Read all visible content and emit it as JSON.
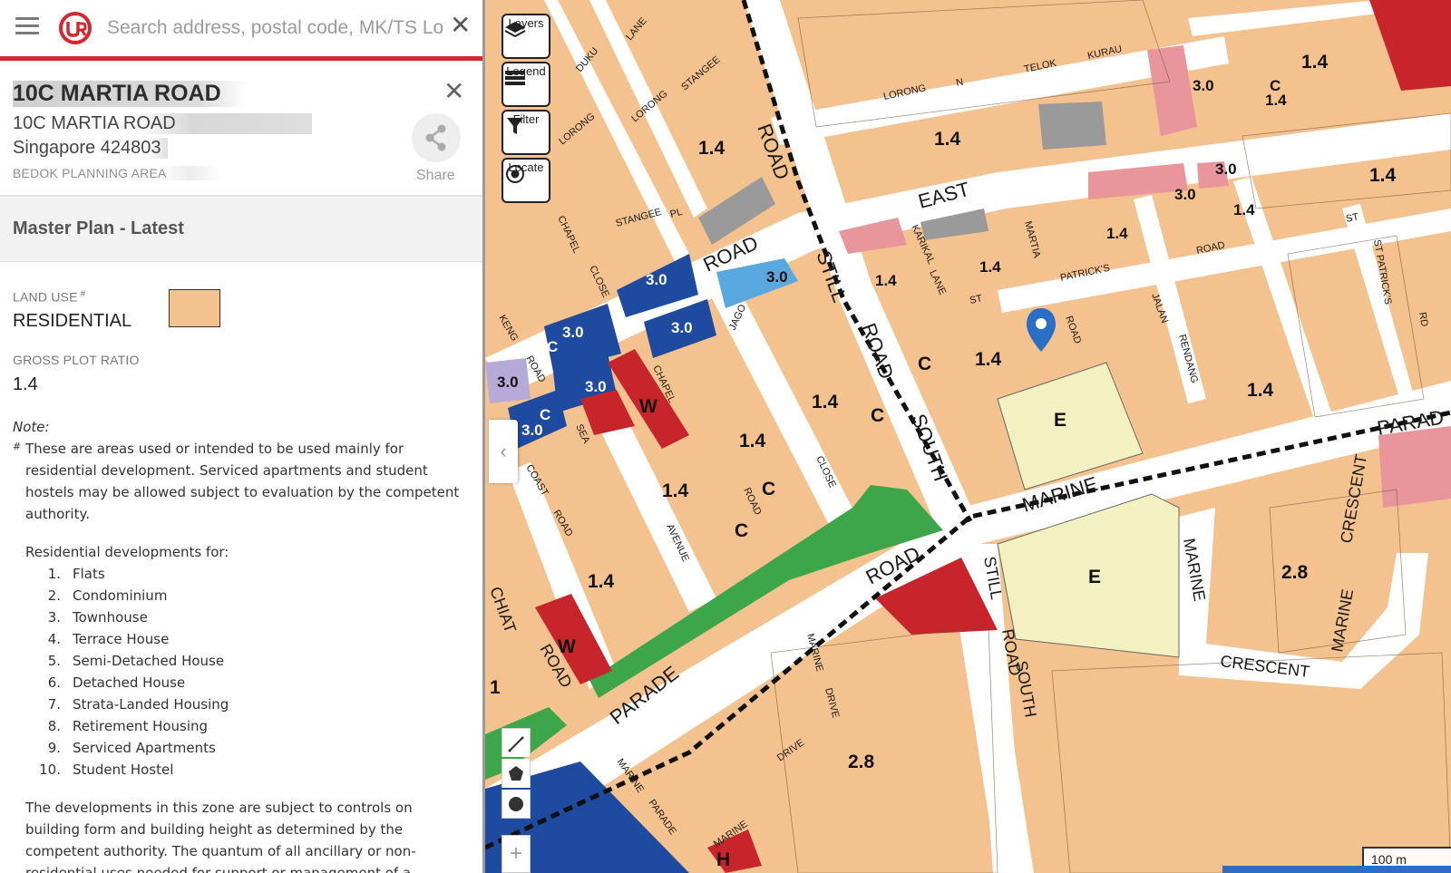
{
  "search": {
    "placeholder": "Search address, postal code, MK/TS Lot"
  },
  "address": {
    "title": "10C MARTIA ROAD",
    "line1": "10C MARTIA ROAD",
    "line2": "Singapore 424803",
    "planning_area": "BEDOK PLANNING AREA",
    "share_label": "Share"
  },
  "master_plan": {
    "title": "Master Plan - Latest",
    "land_use_label": "LAND USE",
    "land_use_sup": "#",
    "land_use_value": "RESIDENTIAL",
    "land_use_color": "#f4c28e",
    "gpr_label": "GROSS PLOT RATIO",
    "gpr_value": "1.4"
  },
  "note": {
    "title": "Note:",
    "hash": "#",
    "text": "These are areas used or intended to be used mainly for residential development. Serviced apartments and student hostels may be allowed subject to evaluation by the competent authority.",
    "res_dev_heading": "Residential developments for:",
    "items": [
      {
        "num": "1.",
        "label": "Flats"
      },
      {
        "num": "2.",
        "label": "Condominium"
      },
      {
        "num": "3.",
        "label": "Townhouse"
      },
      {
        "num": "4.",
        "label": "Terrace House"
      },
      {
        "num": "5.",
        "label": "Semi-Detached House"
      },
      {
        "num": "6.",
        "label": "Detached House"
      },
      {
        "num": "7.",
        "label": "Strata-Landed Housing"
      },
      {
        "num": "8.",
        "label": "Retirement Housing"
      },
      {
        "num": "9.",
        "label": "Serviced Apartments"
      },
      {
        "num": "10.",
        "label": "Student Hostel"
      }
    ],
    "zone_text": "The developments in this zone are subject to controls on building form and building height as determined by the competent authority. The quantum of all ancillary or non-residential uses needed for support or management of a"
  },
  "map_controls": {
    "layers": "Layers",
    "legend": "Legend",
    "filter": "Filter",
    "locate": "Locate"
  },
  "map": {
    "scale_label": "100 m",
    "colors": {
      "residential": "#f4c28e",
      "road": "#ffffff",
      "commercial_res": "#e8959c",
      "civic": "#1e4aa0",
      "business": "#c8242c",
      "park": "#3da64a",
      "education": "#f3f0c2",
      "utility": "#9a9a9a",
      "light_blue": "#5aa8e0",
      "lavender": "#b8aad8"
    },
    "road_labels": [
      "ROAD",
      "STILL",
      "ROAD",
      "SOUTH",
      "EAST",
      "MARINE",
      "ROAD",
      "PARADE",
      "MARINE",
      "PARADE",
      "CRESCENT",
      "MARINE",
      "CRESCENT",
      "STILL",
      "ROAD",
      "SOUTH",
      "LORONG",
      "N",
      "TELOK",
      "KURAU",
      "PATRICK'S",
      "ROAD",
      "ST",
      "JAGO",
      "CLOSE",
      "CHAPEL",
      "ROAD",
      "AVENUE",
      "SEA",
      "ROAD",
      "MARTIA",
      "ROAD",
      "JALAN",
      "RENDANG",
      "KARIKAL",
      "LANE",
      "DUKU",
      "LANE",
      "LORONG",
      "STANGEE",
      "LORONG",
      "CHAPEL",
      "CLOSE",
      "STANGEE",
      "PL",
      "ST PATRICK'S",
      "RD",
      "MARINE",
      "DRIVE",
      "DRIVE",
      "MARINE",
      "PARADE",
      "MARINE",
      "CHIAT",
      "ROAD",
      "KENG",
      "ROAD",
      "COAST",
      "ROAD"
    ],
    "zone_labels": [
      "1.4",
      "1.4",
      "1.4",
      "1.4",
      "1.4",
      "1.4",
      "1.4",
      "1.4",
      "1.4",
      "1.4",
      "1.4",
      "1.4",
      "1.4",
      "1.4",
      "1.4",
      "3.0",
      "3.0",
      "3.0",
      "3.0",
      "3.0",
      "3.0",
      "3.0",
      "3.0",
      "3.0",
      "3.0",
      "2.8",
      "2.8",
      "C",
      "C",
      "C",
      "C",
      "C",
      "C",
      "C",
      "C",
      "W",
      "W",
      "E",
      "E",
      "H",
      "1"
    ]
  }
}
